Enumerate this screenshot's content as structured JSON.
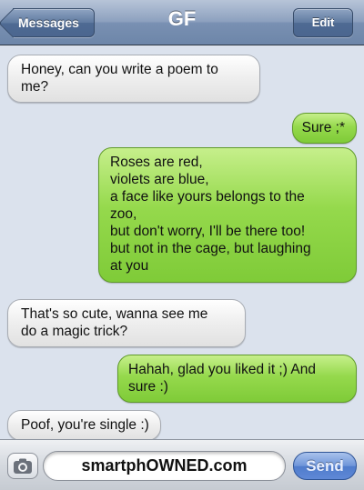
{
  "navbar": {
    "back_label": "Messages",
    "title": "GF",
    "edit_label": "Edit"
  },
  "messages": [
    {
      "direction": "incoming",
      "lines": [
        "Honey, can you write a poem to",
        "me?"
      ]
    },
    {
      "direction": "outgoing",
      "lines": [
        "Sure ;*"
      ]
    },
    {
      "direction": "outgoing",
      "lines": [
        "Roses are red,",
        "violets are blue,",
        "a face like yours belongs to the",
        "zoo,",
        "but don't worry, I'll be there too!",
        "but not in the cage, but laughing",
        "at you"
      ]
    },
    {
      "direction": "incoming",
      "lines": [
        "That's so cute, wanna see me",
        "do a magic trick?"
      ]
    },
    {
      "direction": "outgoing",
      "lines": [
        "Hahah, glad you liked it ;) And",
        "sure :)"
      ]
    },
    {
      "direction": "incoming",
      "lines": [
        "Poof, you're single :)"
      ]
    }
  ],
  "input": {
    "value": "smartphOWNED.com",
    "send_label": "Send"
  },
  "colors": {
    "incoming_bubble": "#eeeeee",
    "outgoing_bubble": "#95d94c",
    "navbar": "#8da1bf",
    "send_button": "#5f88d6"
  },
  "icons": {
    "back": "chevron-left-icon",
    "camera": "camera-icon"
  }
}
